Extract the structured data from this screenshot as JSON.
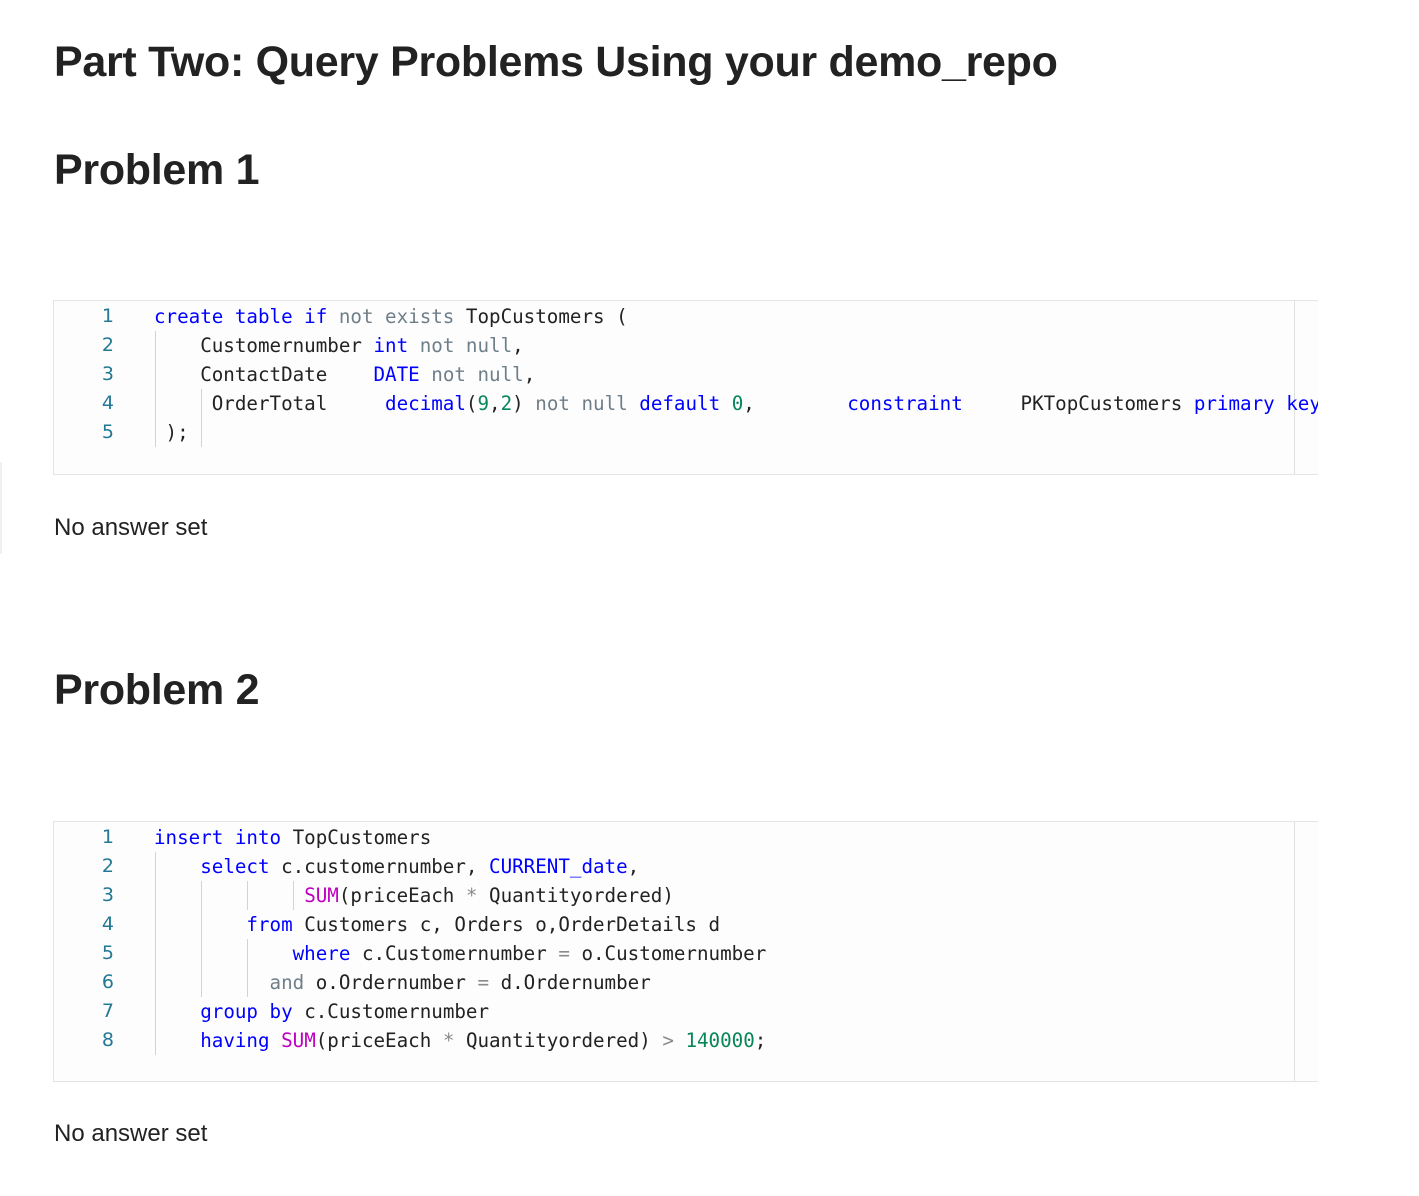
{
  "page_title": "Part Two: Query Problems Using your demo_repo",
  "problems": [
    {
      "heading": "Problem 1",
      "answer_status": "No answer set",
      "code_lines": [
        {
          "num": "1",
          "tokens": [
            [
              "k",
              "create table if"
            ],
            [
              "plain",
              " "
            ],
            [
              "n",
              "not exists"
            ],
            [
              "plain",
              " TopCustomers ("
            ]
          ]
        },
        {
          "num": "2",
          "tokens": [
            [
              "plain",
              "    Customernumber "
            ],
            [
              "k",
              "int"
            ],
            [
              "plain",
              " "
            ],
            [
              "n",
              "not null"
            ],
            [
              "plain",
              ","
            ]
          ]
        },
        {
          "num": "3",
          "tokens": [
            [
              "plain",
              "    ContactDate    "
            ],
            [
              "k",
              "DATE"
            ],
            [
              "plain",
              " "
            ],
            [
              "n",
              "not null"
            ],
            [
              "plain",
              ","
            ]
          ]
        },
        {
          "num": "4",
          "tokens": [
            [
              "plain",
              "     OrderTotal     "
            ],
            [
              "k",
              "decimal"
            ],
            [
              "plain",
              "("
            ],
            [
              "num",
              "9"
            ],
            [
              "plain",
              ","
            ],
            [
              "num",
              "2"
            ],
            [
              "plain",
              ") "
            ],
            [
              "n",
              "not null"
            ],
            [
              "plain",
              " "
            ],
            [
              "k",
              "default"
            ],
            [
              "plain",
              " "
            ],
            [
              "num",
              "0"
            ],
            [
              "plain",
              ",        "
            ],
            [
              "k",
              "constraint"
            ],
            [
              "plain",
              "     PKTopCustomers "
            ],
            [
              "k",
              "primary key"
            ]
          ]
        },
        {
          "num": "5",
          "tokens": [
            [
              "plain",
              " );"
            ]
          ]
        }
      ]
    },
    {
      "heading": "Problem 2",
      "answer_status": "No answer set",
      "code_lines": [
        {
          "num": "1",
          "tokens": [
            [
              "k",
              "insert into"
            ],
            [
              "plain",
              " TopCustomers"
            ]
          ]
        },
        {
          "num": "2",
          "tokens": [
            [
              "plain",
              "    "
            ],
            [
              "k",
              "select"
            ],
            [
              "plain",
              " c.customernumber, "
            ],
            [
              "k",
              "CURRENT_date"
            ],
            [
              "plain",
              ","
            ]
          ]
        },
        {
          "num": "3",
          "tokens": [
            [
              "plain",
              "             "
            ],
            [
              "f",
              "SUM"
            ],
            [
              "plain",
              "(priceEach "
            ],
            [
              "op",
              "*"
            ],
            [
              "plain",
              " Quantityordered)"
            ]
          ]
        },
        {
          "num": "4",
          "tokens": [
            [
              "plain",
              "        "
            ],
            [
              "k",
              "from"
            ],
            [
              "plain",
              " Customers c, Orders o,OrderDetails d"
            ]
          ]
        },
        {
          "num": "5",
          "tokens": [
            [
              "plain",
              "            "
            ],
            [
              "k",
              "where"
            ],
            [
              "plain",
              " c.Customernumber "
            ],
            [
              "op",
              "="
            ],
            [
              "plain",
              " o.Customernumber"
            ]
          ]
        },
        {
          "num": "6",
          "tokens": [
            [
              "plain",
              "          "
            ],
            [
              "n",
              "and"
            ],
            [
              "plain",
              " o.Ordernumber "
            ],
            [
              "op",
              "="
            ],
            [
              "plain",
              " d.Ordernumber"
            ]
          ]
        },
        {
          "num": "7",
          "tokens": [
            [
              "plain",
              "    "
            ],
            [
              "k",
              "group by"
            ],
            [
              "plain",
              " c.Customernumber"
            ]
          ]
        },
        {
          "num": "8",
          "tokens": [
            [
              "plain",
              "    "
            ],
            [
              "k",
              "having"
            ],
            [
              "plain",
              " "
            ],
            [
              "f",
              "SUM"
            ],
            [
              "plain",
              "(priceEach "
            ],
            [
              "op",
              "*"
            ],
            [
              "plain",
              " Quantityordered) "
            ],
            [
              "op",
              ">"
            ],
            [
              "plain",
              " "
            ],
            [
              "num",
              "140000"
            ],
            [
              "plain",
              ";"
            ]
          ]
        }
      ]
    }
  ]
}
